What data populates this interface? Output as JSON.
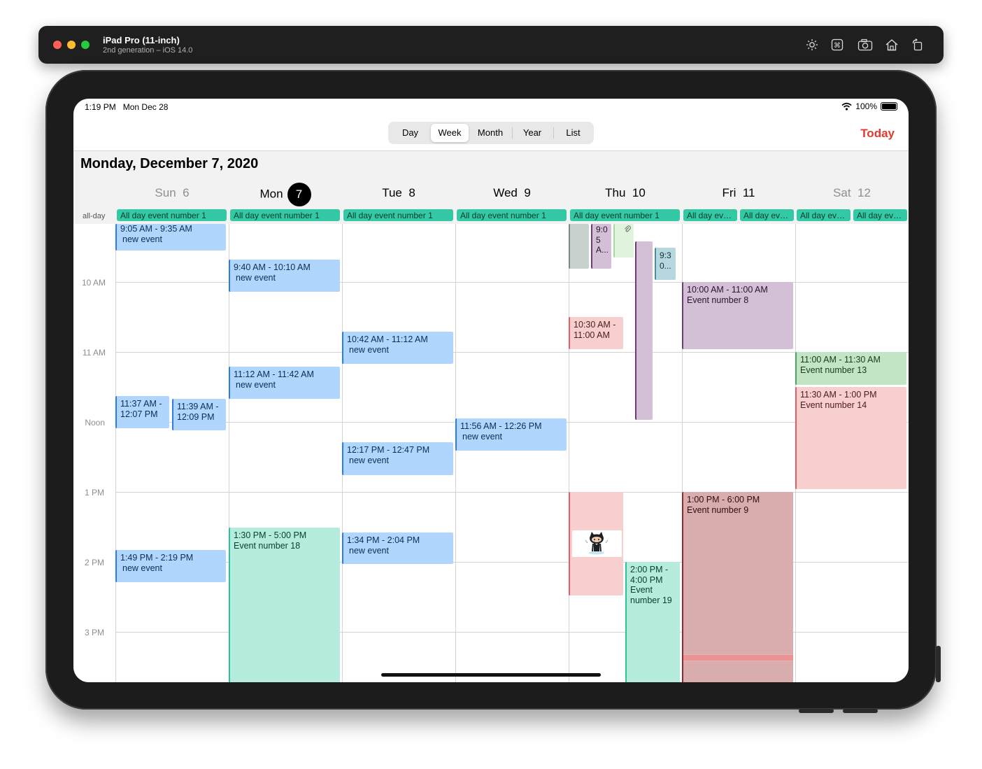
{
  "titlebar": {
    "title": "iPad Pro (11-inch)",
    "subtitle": "2nd generation – iOS 14.0",
    "icons": [
      "brightness-icon",
      "command-icon",
      "screenshot-icon",
      "home-icon",
      "rotate-icon"
    ]
  },
  "status": {
    "time": "1:19 PM",
    "date": "Mon Dec 28",
    "battery": "100%"
  },
  "segments": {
    "day": "Day",
    "week": "Week",
    "month": "Month",
    "year": "Year",
    "list": "List",
    "selected": "Week"
  },
  "today_label": "Today",
  "big_date": "Monday, December 7, 2020",
  "days": [
    {
      "name": "Sun",
      "num": "6"
    },
    {
      "name": "Mon",
      "num": "7"
    },
    {
      "name": "Tue",
      "num": "8"
    },
    {
      "name": "Wed",
      "num": "9"
    },
    {
      "name": "Thu",
      "num": "10"
    },
    {
      "name": "Fri",
      "num": "11"
    },
    {
      "name": "Sat",
      "num": "12"
    }
  ],
  "allday": {
    "label": "all-day",
    "full": "All day event number 1",
    "short": "All day eve..."
  },
  "times": {
    "t10": "10 AM",
    "t11": "11 AM",
    "noon": "Noon",
    "t1": "1 PM",
    "t2": "2 PM",
    "t3": "3 PM"
  },
  "events": {
    "sun1": {
      "time": "9:05 AM - 9:35 AM",
      "title": "new event"
    },
    "sun2": {
      "time": "11:37 AM -",
      "time2": "12:07 PM"
    },
    "sun3": {
      "time": "11:39 AM -",
      "time2": "12:09 PM"
    },
    "sun4": {
      "time": "1:49 PM - 2:19 PM",
      "title": "new event"
    },
    "mon1": {
      "time": "9:40 AM - 10:10 AM",
      "title": "new event"
    },
    "mon2": {
      "time": "11:12 AM - 11:42 AM",
      "title": "new event"
    },
    "mon3": {
      "time": "1:30 PM - 5:00 PM",
      "title": "Event number 18"
    },
    "tue1": {
      "time": "10:42 AM - 11:12 AM",
      "title": "new event"
    },
    "tue2": {
      "time": "12:17 PM - 12:47 PM",
      "title": "new event"
    },
    "tue3": {
      "time": "1:34 PM - 2:04 PM",
      "title": "new event"
    },
    "wed1": {
      "time": "11:56 AM - 12:26 PM",
      "title": "new event"
    },
    "thu1": {
      "l1": "9:0",
      "l2": "5",
      "l3": "A..."
    },
    "thu2": {
      "l1": "9:3",
      "l2": "0..."
    },
    "thu3": {
      "time": "10:30 AM -",
      "time2": "11:00 AM"
    },
    "thu4": {
      "l1": "2:00 PM -",
      "l2": "4:00 PM",
      "l3": "Event",
      "l4": "number 19"
    },
    "fri1": {
      "time": "10:00 AM - 11:00 AM",
      "title": "Event number 8"
    },
    "fri2": {
      "time": "1:00 PM - 6:00 PM",
      "title": "Event number 9"
    },
    "sat1": {
      "time": "11:00 AM - 11:30 AM",
      "title": "Event number 13"
    },
    "sat2": {
      "time": "11:30 AM - 1:00 PM",
      "title": "Event number 14"
    }
  }
}
